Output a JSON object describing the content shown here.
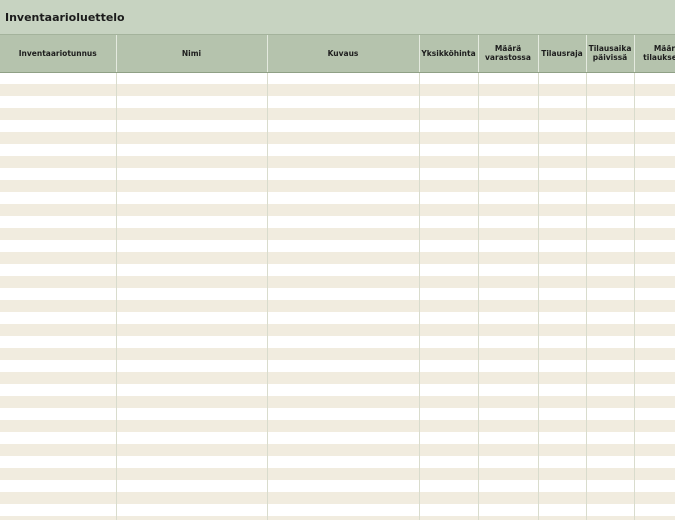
{
  "sheet": {
    "title": "Inventaarioluettelo"
  },
  "table": {
    "columns": [
      "Inventaariotunnus",
      "Nimi",
      "Kuvaus",
      "Yksikköhinta",
      "Määrä varastossa",
      "Tilausraja",
      "Tilausaika päivissä",
      "Määrä tilauksessa"
    ]
  },
  "colors": {
    "title_bg": "#c7d3c1",
    "header_bg": "#b5c3ad",
    "band_light": "#ffffff",
    "band_tan": "#f1ecdf"
  }
}
